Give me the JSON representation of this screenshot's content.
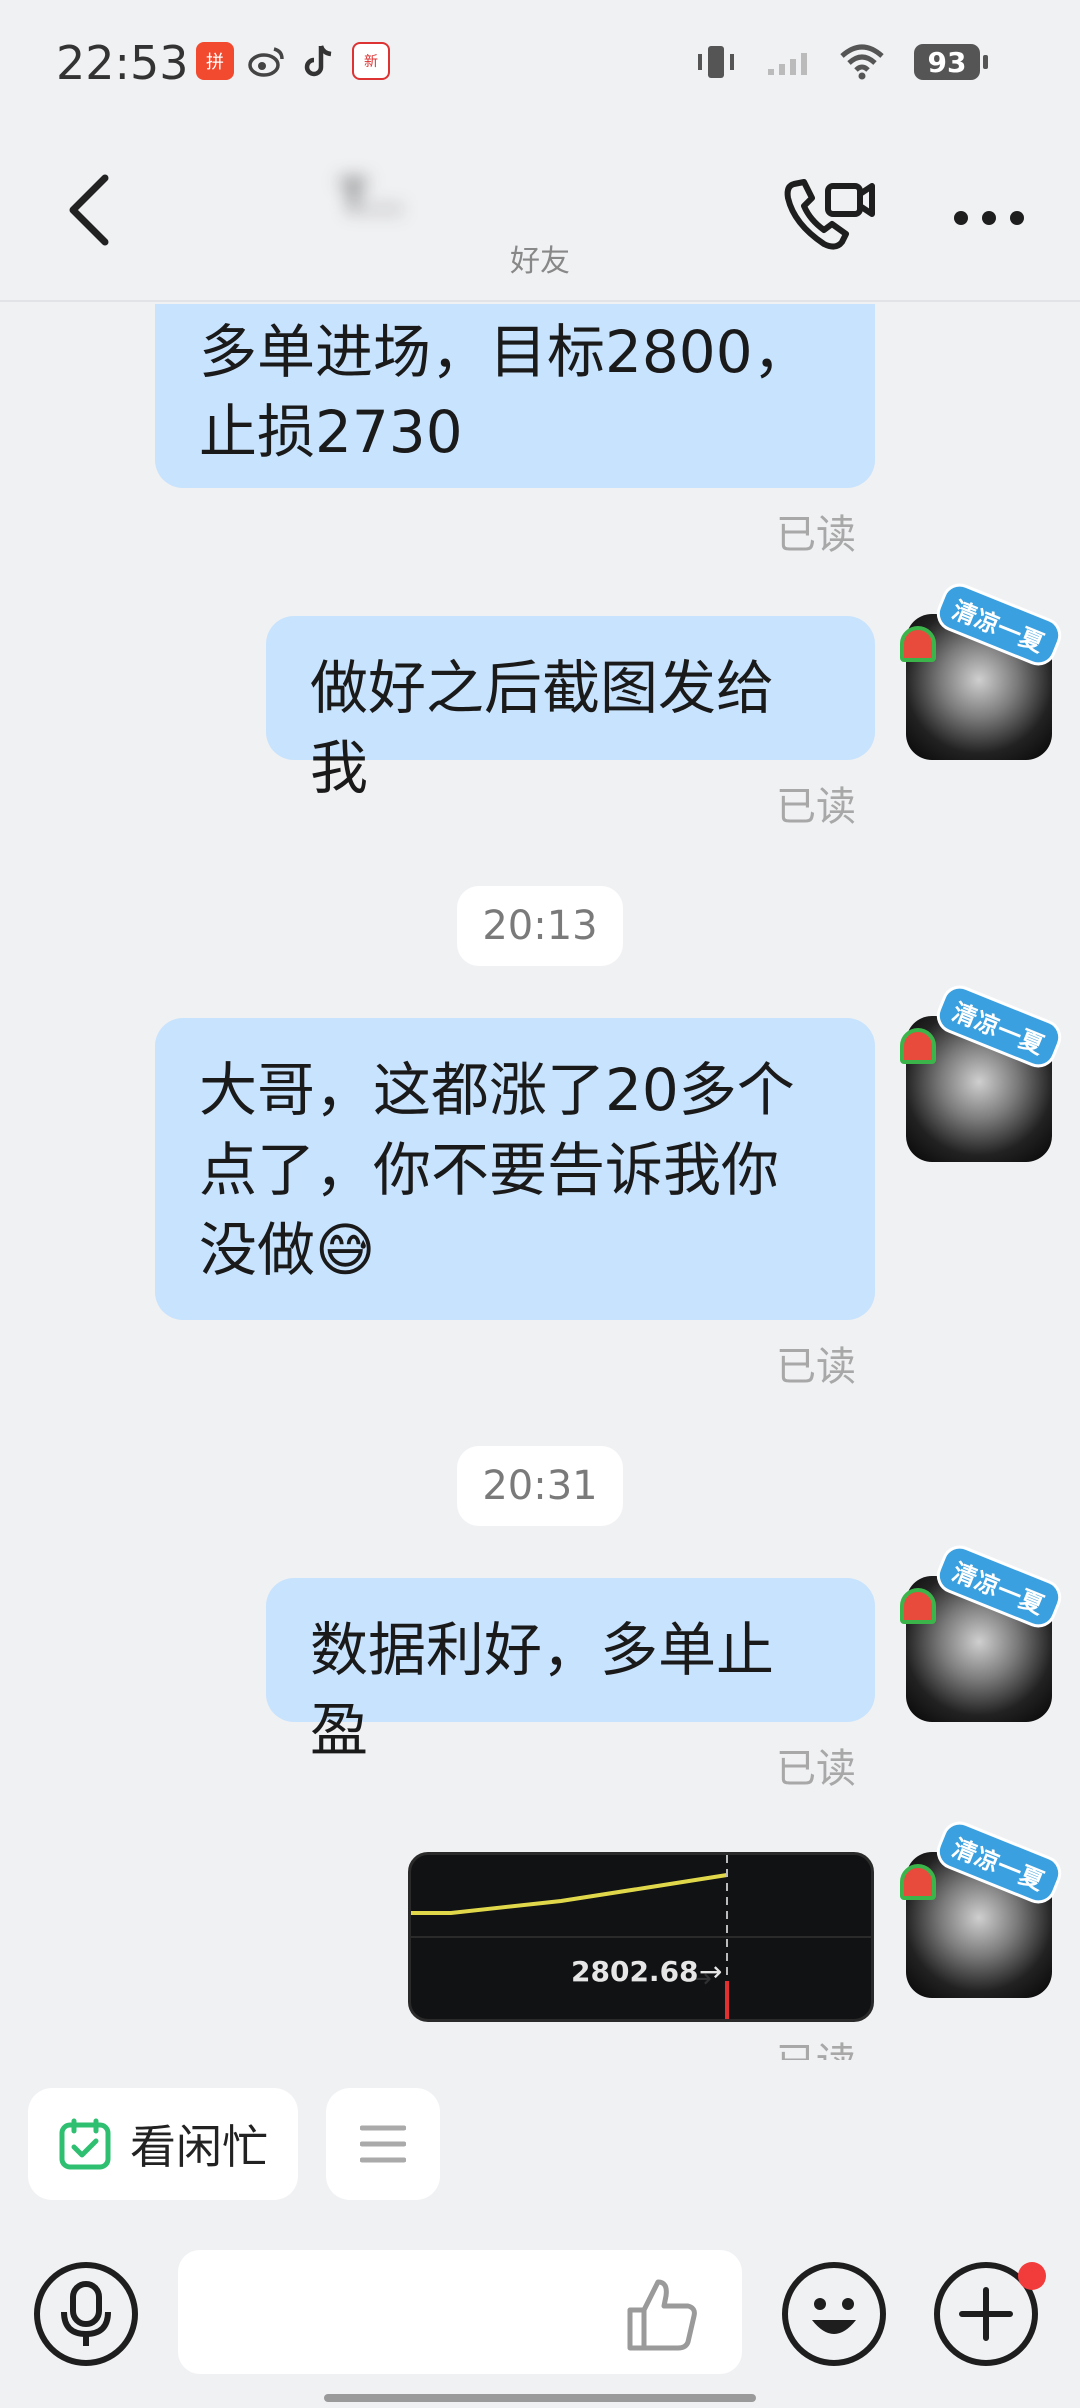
{
  "status_bar": {
    "time": "22:53",
    "battery": "93",
    "app_icons": [
      "pinduoduo-icon",
      "weibo-icon",
      "tiktok-icon",
      "news-app-icon"
    ]
  },
  "header": {
    "contact_name": "T...",
    "contact_sub": "好友"
  },
  "messages": [
    {
      "text_line1": "多单进场，目标2800，",
      "text_line2": "止损2730",
      "read": "已读"
    },
    {
      "text": "做好之后截图发给我",
      "read": "已读"
    },
    {
      "time": "20:13"
    },
    {
      "text_line1": "大哥，这都涨了20多个",
      "text_line2": "点了，你不要告诉我你",
      "text_line3": "没做",
      "emoji": "😅",
      "read": "已读"
    },
    {
      "time": "20:31"
    },
    {
      "text": "数据利好，多单止盈",
      "read": "已读"
    },
    {
      "image_price_label": "2802.68",
      "read": "已读"
    }
  ],
  "avatar_sticker": "清凉一夏",
  "quick_actions": {
    "busy_label": "看闲忙"
  },
  "colors": {
    "bubble": "#c8e3fd",
    "background": "#f0f1f3",
    "accent_green": "#2fbf71",
    "badge_red": "#f23c3c"
  }
}
